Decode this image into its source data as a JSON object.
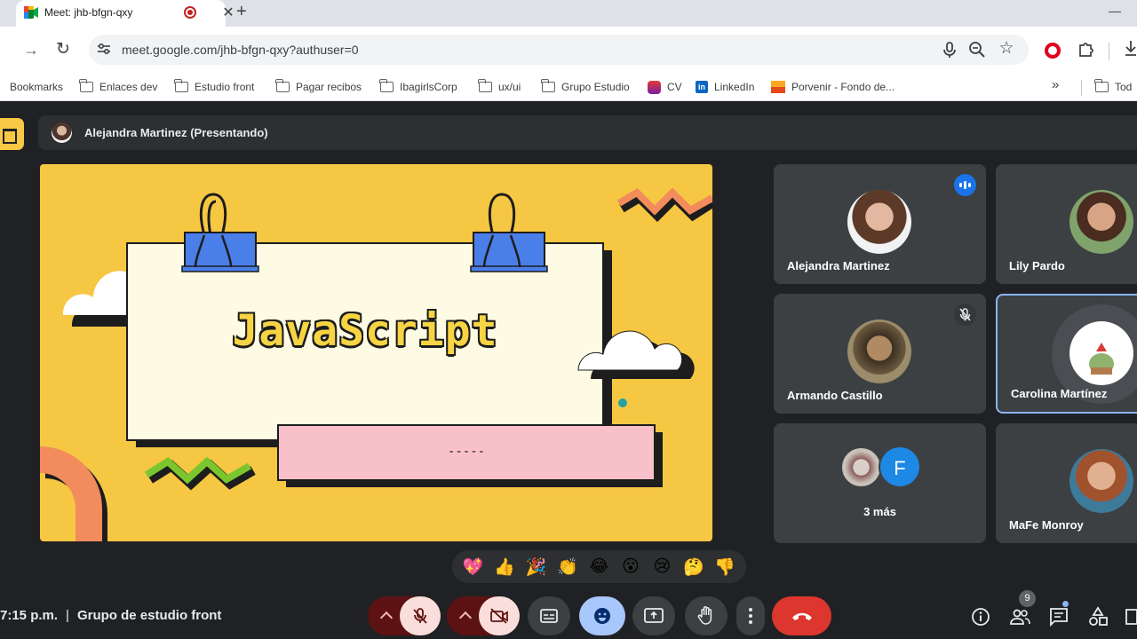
{
  "browser": {
    "tab_title": "Meet: jhb-bfgn-qxy",
    "tab_close": "✕",
    "new_tab": "+",
    "url": "meet.google.com/jhb-bfgn-qxy?authuser=0",
    "bookmarks": [
      {
        "label": "Bookmarks",
        "icon": "none"
      },
      {
        "label": "Enlaces dev",
        "icon": "folder-icon"
      },
      {
        "label": "Estudio front",
        "icon": "folder-icon"
      },
      {
        "label": "Pagar recibos",
        "icon": "folder-icon"
      },
      {
        "label": "IbagirlsCorp",
        "icon": "folder-icon"
      },
      {
        "label": "ux/ui",
        "icon": "folder-icon"
      },
      {
        "label": "Grupo Estudio",
        "icon": "folder-icon"
      },
      {
        "label": "CV",
        "icon": "cv-icon"
      },
      {
        "label": "LinkedIn",
        "icon": "linkedin-icon"
      },
      {
        "label": "Porvenir - Fondo de...",
        "icon": "porvenir-icon"
      },
      {
        "label": "Tod",
        "icon": "folder-icon"
      }
    ],
    "bookmarks_more": "»"
  },
  "meet": {
    "presenter_label": "Alejandra Martinez (Presentando)",
    "slide": {
      "title": "JavaScript",
      "subtitle": "-----"
    },
    "participants": [
      {
        "name": "Alejandra Martinez",
        "status": "speaking"
      },
      {
        "name": "Lily Pardo",
        "status": "none"
      },
      {
        "name": "Armando Castillo",
        "status": "muted"
      },
      {
        "name": "Carolina Martínez",
        "status": "selected"
      },
      {
        "name": "3 más",
        "status": "overflow",
        "initial": "F"
      },
      {
        "name": "MaFe Monroy",
        "status": "none"
      }
    ],
    "reactions": [
      "💖",
      "👍",
      "🎉",
      "👏",
      "😂",
      "😮",
      "😢",
      "🤔",
      "👎"
    ],
    "time": "7:15 p.m.",
    "separator": "|",
    "meeting_name": "Grupo de estudio front",
    "people_count": "9",
    "colors": {
      "background": "#202124",
      "tile": "#3c4043",
      "slide_yellow": "#f6c743",
      "accent_blue": "#1a73e8",
      "end_call": "#dc362e",
      "mic_off": "#f9dedc"
    }
  }
}
